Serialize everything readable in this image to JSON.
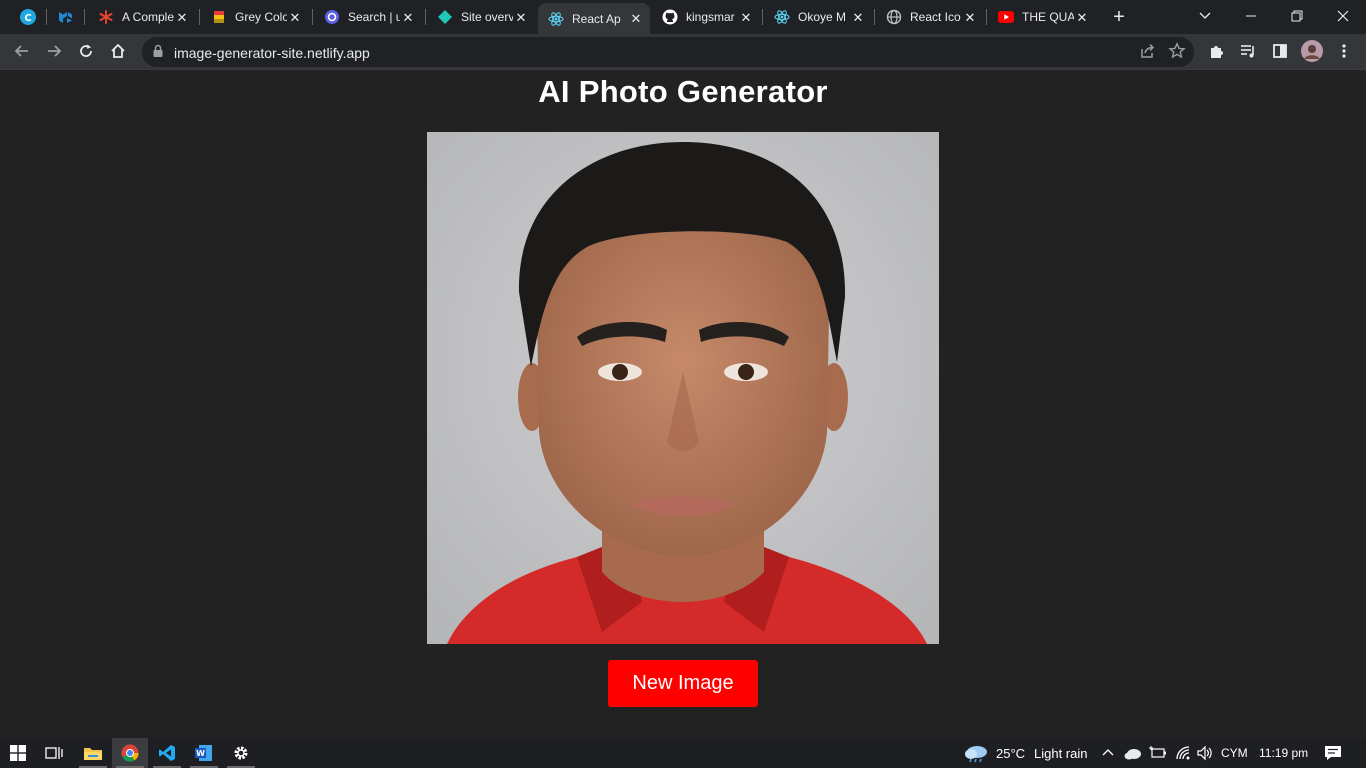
{
  "browser": {
    "tabs": [
      {
        "title": "",
        "icon": "canva-icon",
        "pinned": true
      },
      {
        "title": "",
        "icon": "mui-icon",
        "pinned": true
      },
      {
        "title": "A Comple",
        "icon": "asterisk-icon"
      },
      {
        "title": "Grey Colo",
        "icon": "palette-icon"
      },
      {
        "title": "Search | u",
        "icon": "search-site-icon"
      },
      {
        "title": "Site overv",
        "icon": "netlify-icon"
      },
      {
        "title": "React Ap",
        "icon": "react-icon",
        "active": true
      },
      {
        "title": "kingsmar",
        "icon": "github-icon"
      },
      {
        "title": "Okoye M",
        "icon": "react-icon"
      },
      {
        "title": "React Ico",
        "icon": "globe-icon"
      },
      {
        "title": "THE QUA",
        "icon": "youtube-icon"
      }
    ],
    "url": "image-generator-site.netlify.app"
  },
  "page": {
    "title": "AI Photo Generator",
    "button_label": "New Image"
  },
  "taskbar": {
    "weather_temp": "25°C",
    "weather_desc": "Light rain",
    "language": "CYM",
    "time": "11:19 pm"
  },
  "colors": {
    "page_bg": "#222222",
    "button_bg": "#ff0000",
    "tabstrip_bg": "#202124",
    "toolbar_bg": "#35363a"
  }
}
